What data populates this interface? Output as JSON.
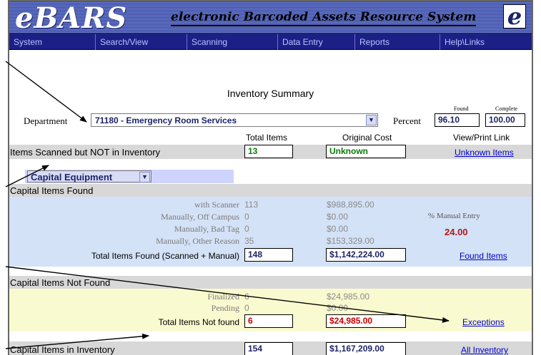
{
  "header": {
    "logo": "eBARS",
    "tagline": "electronic Barcoded Assets Resource System",
    "badge": "e"
  },
  "menu": [
    "System",
    "Search/View",
    "Scanning",
    "Data Entry",
    "Reports",
    "Help\\Links"
  ],
  "page": {
    "title": "Inventory Summary",
    "department_label": "Department",
    "department_value": "71180 - Emergency Room Services",
    "percent_label": "Percent",
    "found_label": "Found",
    "complete_label": "Complete",
    "found_pct": "96.10",
    "complete_pct": "100.00"
  },
  "columns": {
    "total_items": "Total Items",
    "original_cost": "Original Cost",
    "view_print": "View/Print Link"
  },
  "not_in_inventory": {
    "label": "Items Scanned but NOT in Inventory",
    "total": "13",
    "cost": "Unknown",
    "link": "Unknown Items"
  },
  "category": {
    "selected": "Capital Equipment"
  },
  "found": {
    "section_label": "Capital Items Found",
    "rows": [
      {
        "label": "with Scanner",
        "count": "113",
        "cost": "$988,895.00"
      },
      {
        "label": "Manually, Off Campus",
        "count": "0",
        "cost": "$0.00"
      },
      {
        "label": "Manually, Bad Tag",
        "count": "0",
        "cost": "$0.00"
      },
      {
        "label": "Manually, Other Reason",
        "count": "35",
        "cost": "$153,329.00"
      }
    ],
    "manual_entry_label": "% Manual Entry",
    "manual_entry_value": "24.00",
    "total_label": "Total Items Found (Scanned + Manual)",
    "total": "148",
    "total_cost": "$1,142,224.00",
    "link": "Found Items"
  },
  "not_found": {
    "section_label": "Capital Items Not Found",
    "rows": [
      {
        "label": "Finalized",
        "count": "6",
        "cost": "$24,985.00"
      },
      {
        "label": "Pending",
        "count": "0",
        "cost": "$0.00"
      }
    ],
    "total_label": "Total Items Not found",
    "total": "6",
    "total_cost": "$24,985.00",
    "link": "Exceptions"
  },
  "inventory": {
    "label": "Capital Items in Inventory",
    "total": "154",
    "total_cost": "$1,167,209.00",
    "link": "All Inventory"
  },
  "colors": {
    "menu_bg": "#1c1f86",
    "found_bg": "#d4e2f7",
    "not_found_bg": "#fafad0",
    "green_value": "#0a7a0a",
    "red_value": "#cc0000",
    "link": "#0000cc"
  }
}
